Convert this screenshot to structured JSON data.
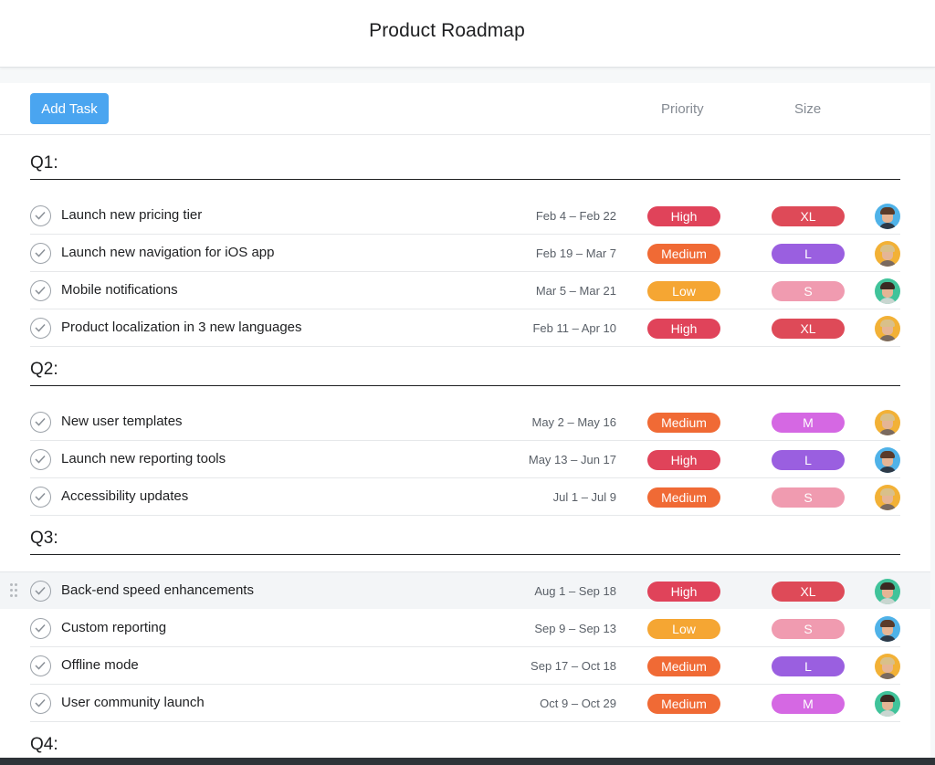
{
  "header": {
    "title": "Product Roadmap"
  },
  "toolbar": {
    "add_task_label": "Add Task",
    "priority_header": "Priority",
    "size_header": "Size"
  },
  "colors": {
    "priority": {
      "High": "#e0435a",
      "Medium": "#f06a35",
      "Low": "#f5a633"
    },
    "size": {
      "XL": "#de4a58",
      "L": "#9a5fe0",
      "M": "#d568e3",
      "S": "#f09bb0"
    },
    "avatar_bg": {
      "blue": "#4fb2e8",
      "yellow": "#f2b136",
      "green": "#40c39a"
    }
  },
  "sections": [
    {
      "label": "Q1:",
      "tasks": [
        {
          "name": "Launch new pricing tier",
          "dates": "Feb 4 – Feb 22",
          "priority": "High",
          "size": "XL",
          "avatar": "blue"
        },
        {
          "name": "Launch new navigation for iOS app",
          "dates": "Feb 19 – Mar 7",
          "priority": "Medium",
          "size": "L",
          "avatar": "yellow"
        },
        {
          "name": "Mobile notifications",
          "dates": "Mar 5 – Mar 21",
          "priority": "Low",
          "size": "S",
          "avatar": "green"
        },
        {
          "name": "Product localization in 3 new languages",
          "dates": "Feb 11 – Apr 10",
          "priority": "High",
          "size": "XL",
          "avatar": "yellow"
        }
      ]
    },
    {
      "label": "Q2:",
      "tasks": [
        {
          "name": "New user templates",
          "dates": "May 2 – May 16",
          "priority": "Medium",
          "size": "M",
          "avatar": "yellow"
        },
        {
          "name": "Launch new reporting tools",
          "dates": "May 13 – Jun 17",
          "priority": "High",
          "size": "L",
          "avatar": "blue"
        },
        {
          "name": "Accessibility updates",
          "dates": "Jul 1 – Jul 9",
          "priority": "Medium",
          "size": "S",
          "avatar": "yellow"
        }
      ]
    },
    {
      "label": "Q3:",
      "tasks": [
        {
          "name": "Back-end speed enhancements",
          "dates": "Aug 1 – Sep 18",
          "priority": "High",
          "size": "XL",
          "avatar": "green",
          "highlighted": true
        },
        {
          "name": "Custom reporting",
          "dates": "Sep 9 – Sep 13",
          "priority": "Low",
          "size": "S",
          "avatar": "blue"
        },
        {
          "name": "Offline mode",
          "dates": "Sep 17 – Oct 18",
          "priority": "Medium",
          "size": "L",
          "avatar": "yellow"
        },
        {
          "name": "User community launch",
          "dates": "Oct 9 – Oct 29",
          "priority": "Medium",
          "size": "M",
          "avatar": "green"
        }
      ]
    },
    {
      "label": "Q4:",
      "tasks": []
    }
  ]
}
